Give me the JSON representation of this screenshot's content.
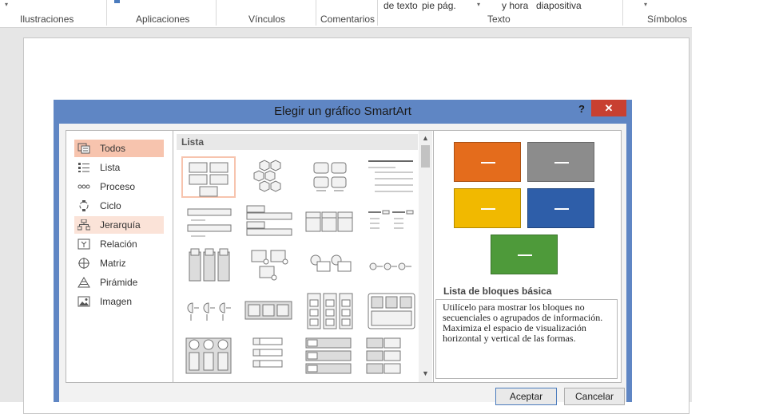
{
  "ribbon": {
    "groups": [
      "Ilustraciones",
      "Aplicaciones",
      "Vínculos",
      "Comentarios",
      "Texto",
      "Símbolos"
    ],
    "text_top_items": [
      "de texto",
      "pie pág.",
      "y hora",
      "diapositiva"
    ]
  },
  "dialog": {
    "title": "Elegir un gráfico SmartArt",
    "help": "?",
    "close": "✕",
    "categories": [
      {
        "label": "Todos",
        "icon": "all-icon"
      },
      {
        "label": "Lista",
        "icon": "list-icon"
      },
      {
        "label": "Proceso",
        "icon": "process-icon"
      },
      {
        "label": "Ciclo",
        "icon": "cycle-icon"
      },
      {
        "label": "Jerarquía",
        "icon": "hierarchy-icon"
      },
      {
        "label": "Relación",
        "icon": "relationship-icon"
      },
      {
        "label": "Matriz",
        "icon": "matrix-icon"
      },
      {
        "label": "Pirámide",
        "icon": "pyramid-icon"
      },
      {
        "label": "Imagen",
        "icon": "picture-icon"
      }
    ],
    "selected_category": "Todos",
    "gallery_header": "Lista",
    "preview": {
      "colors": [
        "#e46c1c",
        "#8c8c8c",
        "#f1b900",
        "#2e5ea9",
        "#4e9a3a"
      ],
      "title": "Lista de bloques básica",
      "description": "Utilícelo para mostrar los bloques no secuenciales o agrupados de información. Maximiza el espacio de visualización horizontal y vertical de las formas."
    },
    "buttons": {
      "ok": "Aceptar",
      "cancel": "Cancelar"
    }
  }
}
